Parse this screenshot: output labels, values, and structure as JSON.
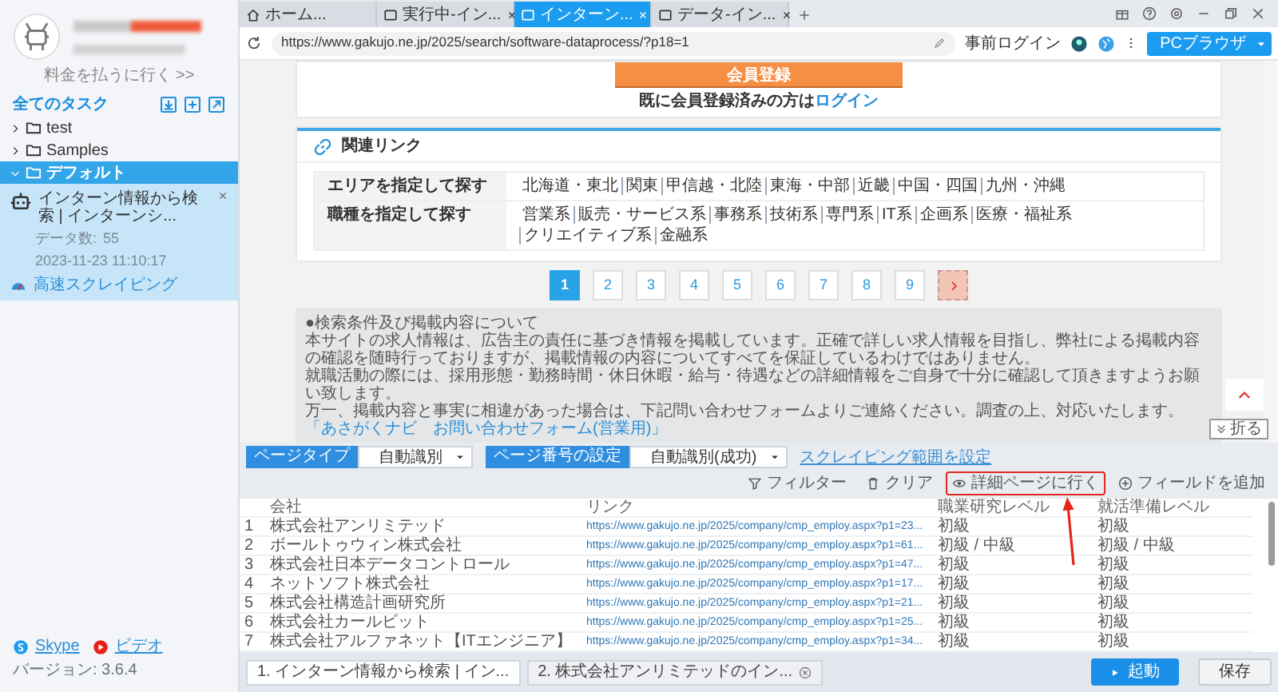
{
  "sidebar": {
    "upgrade_link": "料金を払うに行く >>",
    "section_title": "全てのタスク",
    "folders": [
      {
        "label": "test",
        "expanded": false,
        "selected": false
      },
      {
        "label": "Samples",
        "expanded": false,
        "selected": false
      },
      {
        "label": "デフォルト",
        "expanded": true,
        "selected": true,
        "children": [
          {
            "title": "インターン情報から検索 | インターンシ...",
            "data_count_label": "データ数:",
            "data_count": "55",
            "timestamp": "2023-11-23 11:10:17",
            "mode_link": "高速スクレイピング"
          }
        ]
      }
    ],
    "footer_links": [
      "Skype",
      "ビデオ"
    ],
    "version": "バージョン: 3.6.4"
  },
  "browser": {
    "tabs": [
      {
        "label": "ホーム...",
        "kind": "home",
        "selected": false,
        "closable": false
      },
      {
        "label": "実行中-イン...",
        "kind": "page",
        "selected": false,
        "closable": true
      },
      {
        "label": "インターン...",
        "kind": "page",
        "selected": true,
        "closable": true
      },
      {
        "label": "データ-イン...",
        "kind": "page",
        "selected": false,
        "closable": true
      }
    ],
    "url": "https://www.gakujo.ne.jp/2025/search/software-dataprocess/?p18=1",
    "prelogin": "事前ログイン",
    "mode_button": "PCブラウザ"
  },
  "web_page": {
    "register_button": "会員登録",
    "login_prompt": "既に会員登録済みの方は",
    "login_link": "ログイン",
    "related_links": {
      "title": "関連リンク",
      "rows": [
        {
          "label": "エリアを指定して探す",
          "links": [
            "北海道・東北",
            "関東",
            "甲信越・北陸",
            "東海・中部",
            "近畿",
            "中国・四国",
            "九州・沖縄"
          ]
        },
        {
          "label": "職種を指定して探す",
          "links": [
            "営業系",
            "販売・サービス系",
            "事務系",
            "技術系",
            "専門系",
            "IT系",
            "企画系",
            "医療・福祉系",
            "クリエイティブ系",
            "金融系"
          ]
        }
      ]
    },
    "pagination": [
      {
        "label": "1",
        "selected": true
      },
      {
        "label": "2",
        "selected": false
      },
      {
        "label": "3",
        "selected": false
      },
      {
        "label": "4",
        "selected": false
      },
      {
        "label": "5",
        "selected": false
      },
      {
        "label": "6",
        "selected": false
      },
      {
        "label": "7",
        "selected": false
      },
      {
        "label": "8",
        "selected": false
      },
      {
        "label": "9",
        "selected": false
      }
    ],
    "notice": {
      "title": "●検索条件及び掲載内容について",
      "paragraphs": [
        "本サイトの求人情報は、広告主の責任に基づき情報を掲載しています。正確で詳しい求人情報を目指し、弊社による掲載内容の確認を随時行っておりますが、掲載情報の内容についてすべてを保証しているわけではありません。",
        "就職活動の際には、採用形態・勤務時間・休日休暇・給与・待遇などの詳細情報をご自身で十分に確認して頂きますようお願い致します。",
        "万一、掲載内容と事実に相違があった場合は、下記問い合わせフォームよりご連絡ください。調査の上、対応いたします。"
      ],
      "link": "「あさがくナビ　お問い合わせフォーム(営業用)」"
    }
  },
  "collapse_button": "折る",
  "toolbar": {
    "page_type_label": "ページタイプ",
    "page_type_value": "自動識別",
    "page_number_label": "ページ番号の設定",
    "page_number_value": "自動識別(成功)",
    "range_link": "スクレイピング範囲を設定",
    "actions": [
      {
        "kind": "filter",
        "label": "フィルター",
        "highlighted": false
      },
      {
        "kind": "clear",
        "label": "クリア",
        "highlighted": false
      },
      {
        "kind": "detail",
        "label": "詳細ページに行く",
        "highlighted": true
      },
      {
        "kind": "add",
        "label": "フィールドを追加",
        "highlighted": false
      }
    ]
  },
  "table": {
    "columns": [
      "会社",
      "リンク",
      "職業研究レベル",
      "就活準備レベル"
    ],
    "rows": [
      {
        "index": "1",
        "cells": [
          "株式会社アンリミテッド",
          "https://www.gakujo.ne.jp/2025/company/cmp_employ.aspx?p1=23...",
          "初級",
          "初級"
        ]
      },
      {
        "index": "2",
        "cells": [
          "ボールトゥウィン株式会社",
          "https://www.gakujo.ne.jp/2025/company/cmp_employ.aspx?p1=61...",
          "初級 / 中級",
          "初級 / 中級"
        ]
      },
      {
        "index": "3",
        "cells": [
          "株式会社日本データコントロール",
          "https://www.gakujo.ne.jp/2025/company/cmp_employ.aspx?p1=47...",
          "初級",
          "初級"
        ]
      },
      {
        "index": "4",
        "cells": [
          "ネットソフト株式会社",
          "https://www.gakujo.ne.jp/2025/company/cmp_employ.aspx?p1=17...",
          "初級",
          "初級"
        ]
      },
      {
        "index": "5",
        "cells": [
          "株式会社構造計画研究所",
          "https://www.gakujo.ne.jp/2025/company/cmp_employ.aspx?p1=21...",
          "初級",
          "初級"
        ]
      },
      {
        "index": "6",
        "cells": [
          "株式会社カールビット",
          "https://www.gakujo.ne.jp/2025/company/cmp_employ.aspx?p1=25...",
          "初級",
          "初級"
        ]
      },
      {
        "index": "7",
        "cells": [
          "株式会社アルファネット【ITエンジニア】",
          "https://www.gakujo.ne.jp/2025/company/cmp_employ.aspx?p1=34...",
          "初級",
          "初級"
        ]
      }
    ]
  },
  "run_tabs": [
    {
      "label": "1. インターン情報から検索 | イン...",
      "selected": true,
      "closable": false
    },
    {
      "label": "2. 株式会社アンリミテッドのイン...",
      "selected": false,
      "closable": true
    }
  ],
  "start_button": "起動",
  "save_button": "保存"
}
